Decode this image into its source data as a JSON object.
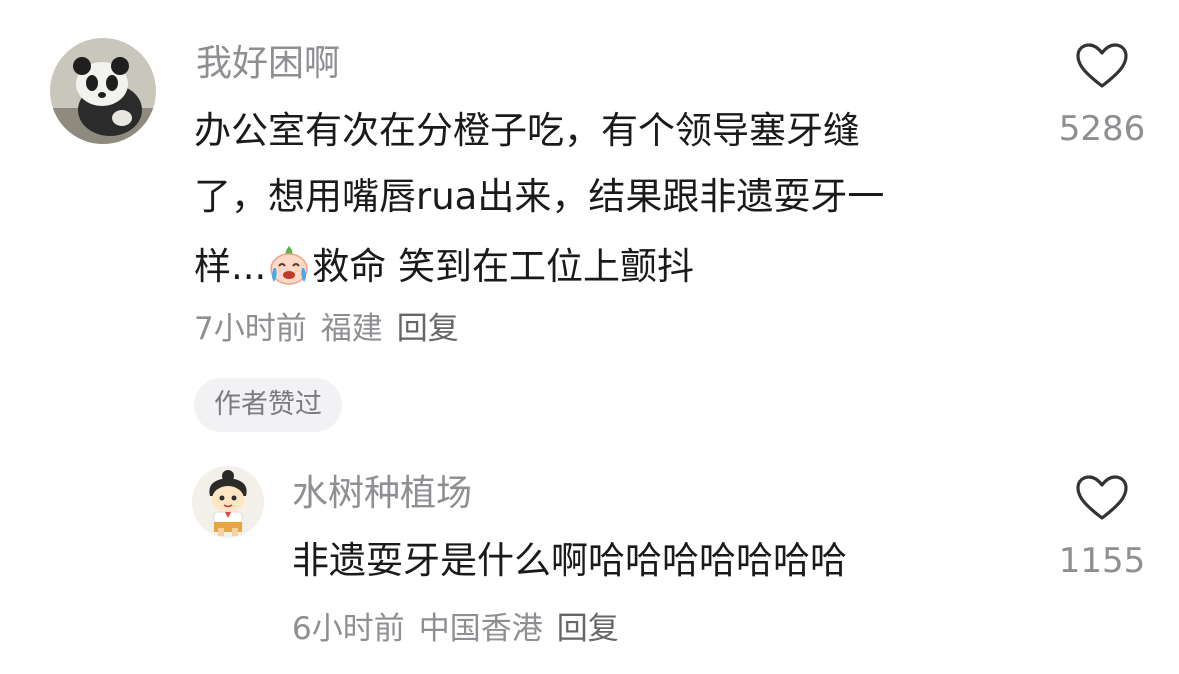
{
  "comments": [
    {
      "avatar": "panda-avatar",
      "username": "我好困啊",
      "lines": [
        "办公室有次在分橙子吃，有个领导塞牙缝",
        "了，想用嘴唇rua出来，结果跟非遗耍牙一",
        "样..."
      ],
      "line3_after_emoji": "救命 笑到在工位上颤抖",
      "emoji": "laughing-crying-emoji",
      "time": "7小时前",
      "location": "福建",
      "reply_label": "回复",
      "badge": "作者赞过",
      "likes": "5286"
    },
    {
      "avatar": "cartoon-girl-avatar",
      "username": "水树种植场",
      "text": "非遗耍牙是什么啊哈哈哈哈哈哈哈",
      "time": "6小时前",
      "location": "中国香港",
      "reply_label": "回复",
      "likes": "1155"
    }
  ],
  "colors": {
    "username": "#8e8e93",
    "body": "#1a1a1a",
    "meta": "#8e8e93",
    "badge_bg": "#f2f2f4",
    "heart_stroke": "#333333"
  },
  "icons": {
    "like": "heart-outline-icon"
  }
}
